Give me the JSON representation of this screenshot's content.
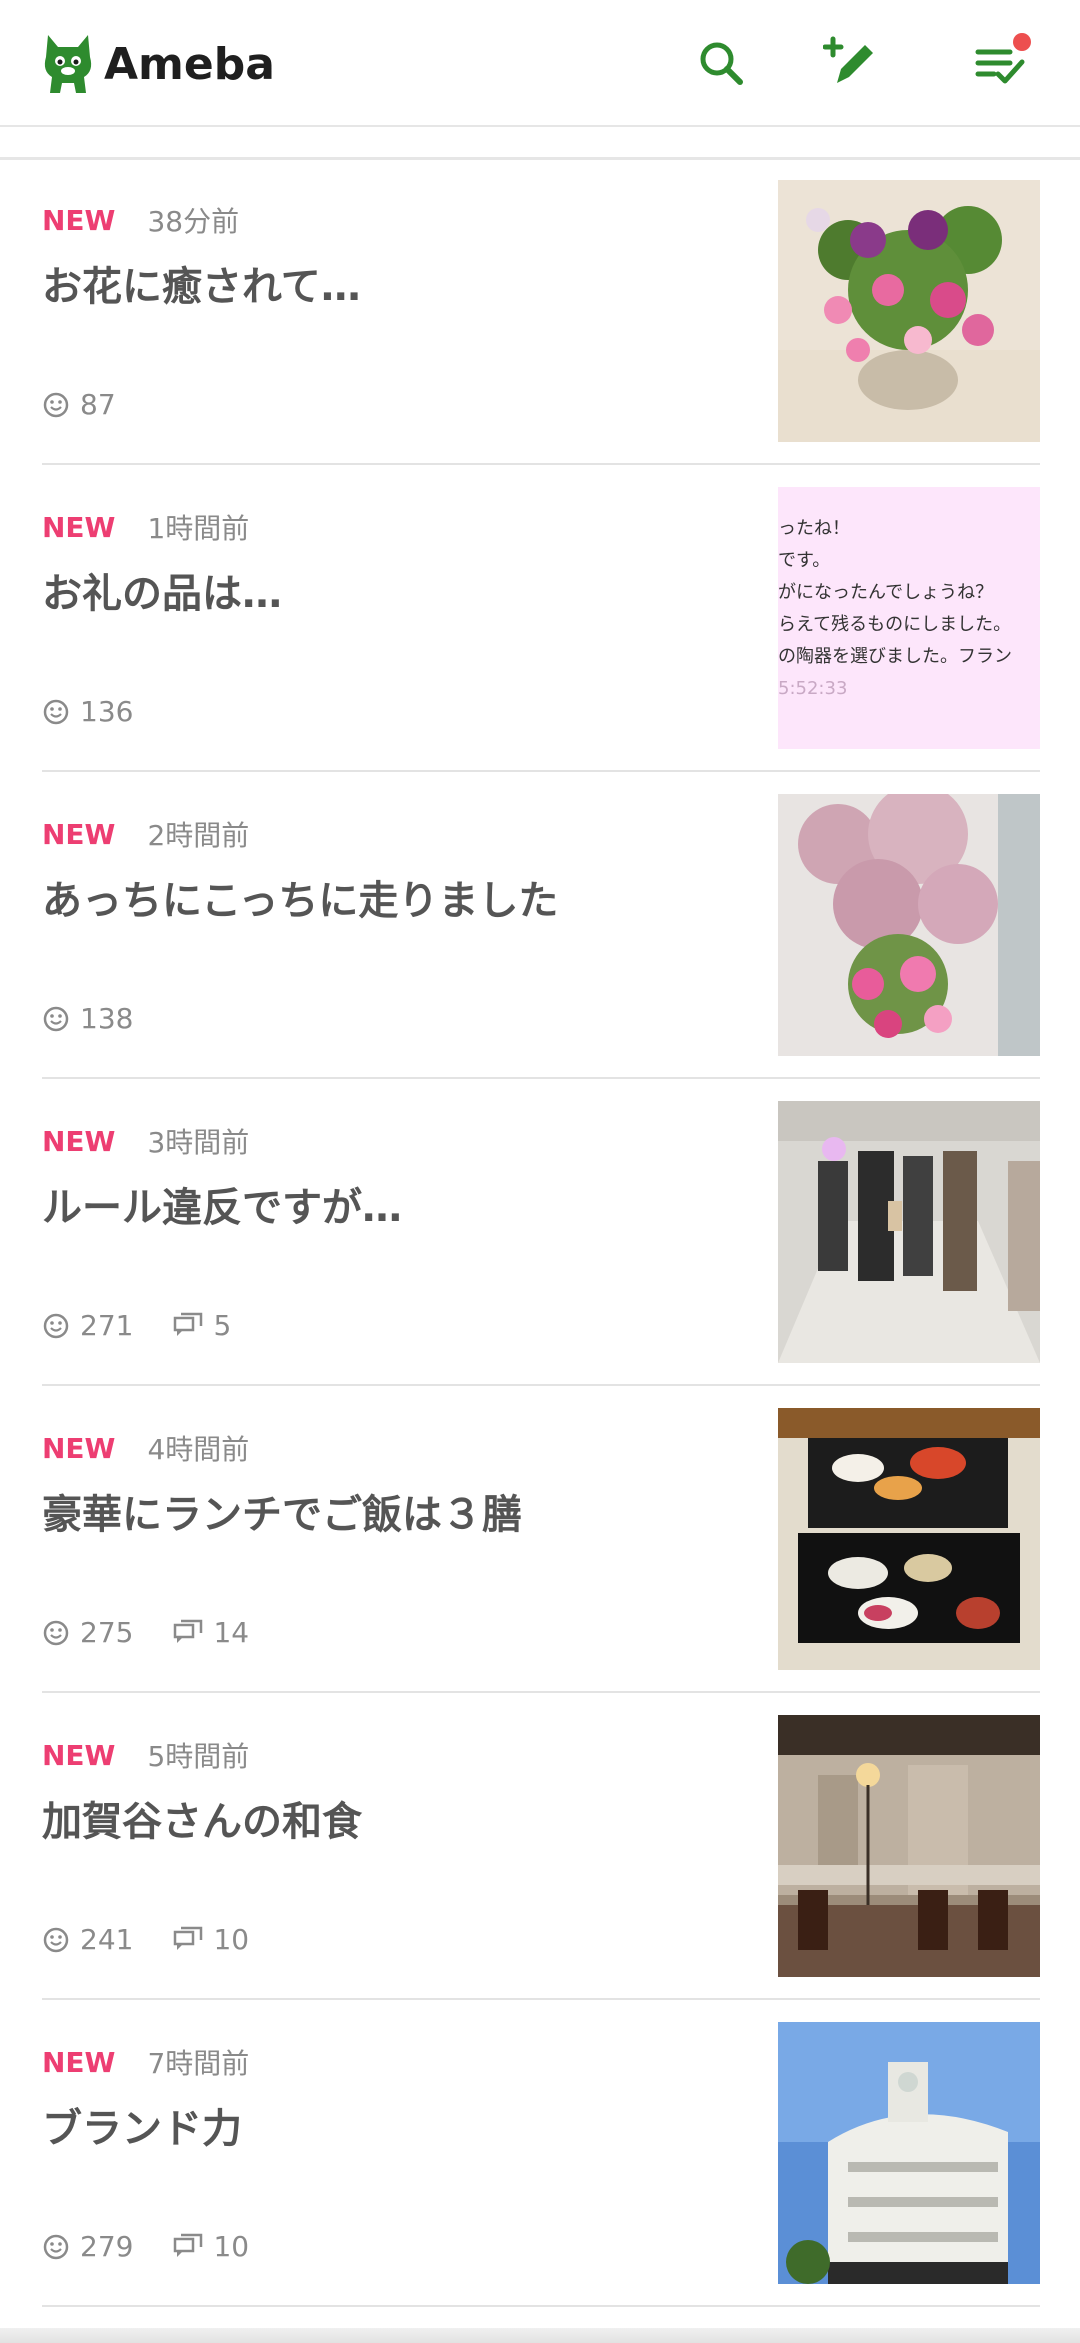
{
  "header": {
    "logo_text": "Ameba",
    "search_icon": "search-icon",
    "write_icon": "pen-plus-icon",
    "feed_icon": "checklist-icon",
    "brand_color": "#2e8b2e",
    "notification_color": "#ed4f4f"
  },
  "entries": [
    {
      "new_label": "NEW",
      "time": "38分前",
      "title": "お花に癒されて…",
      "likes": "87",
      "comments": ""
    },
    {
      "new_label": "NEW",
      "time": "1時間前",
      "title": "お礼の品は…",
      "likes": "136",
      "comments": "",
      "thumb_text": [
        "ったね！",
        "です。",
        "がになったんでしょうね？",
        "らえて残るものにしました。",
        "の陶器を選びました。フラン",
        "5:52:33"
      ]
    },
    {
      "new_label": "NEW",
      "time": "2時間前",
      "title": "あっちにこっちに走りました",
      "likes": "138",
      "comments": ""
    },
    {
      "new_label": "NEW",
      "time": "3時間前",
      "title": "ルール違反ですが…",
      "likes": "271",
      "comments": "5"
    },
    {
      "new_label": "NEW",
      "time": "4時間前",
      "title": "豪華にランチでご飯は３膳",
      "likes": "275",
      "comments": "14"
    },
    {
      "new_label": "NEW",
      "time": "5時間前",
      "title": "加賀谷さんの和食",
      "likes": "241",
      "comments": "10"
    },
    {
      "new_label": "NEW",
      "time": "7時間前",
      "title": "ブランド力",
      "likes": "279",
      "comments": "10"
    }
  ]
}
